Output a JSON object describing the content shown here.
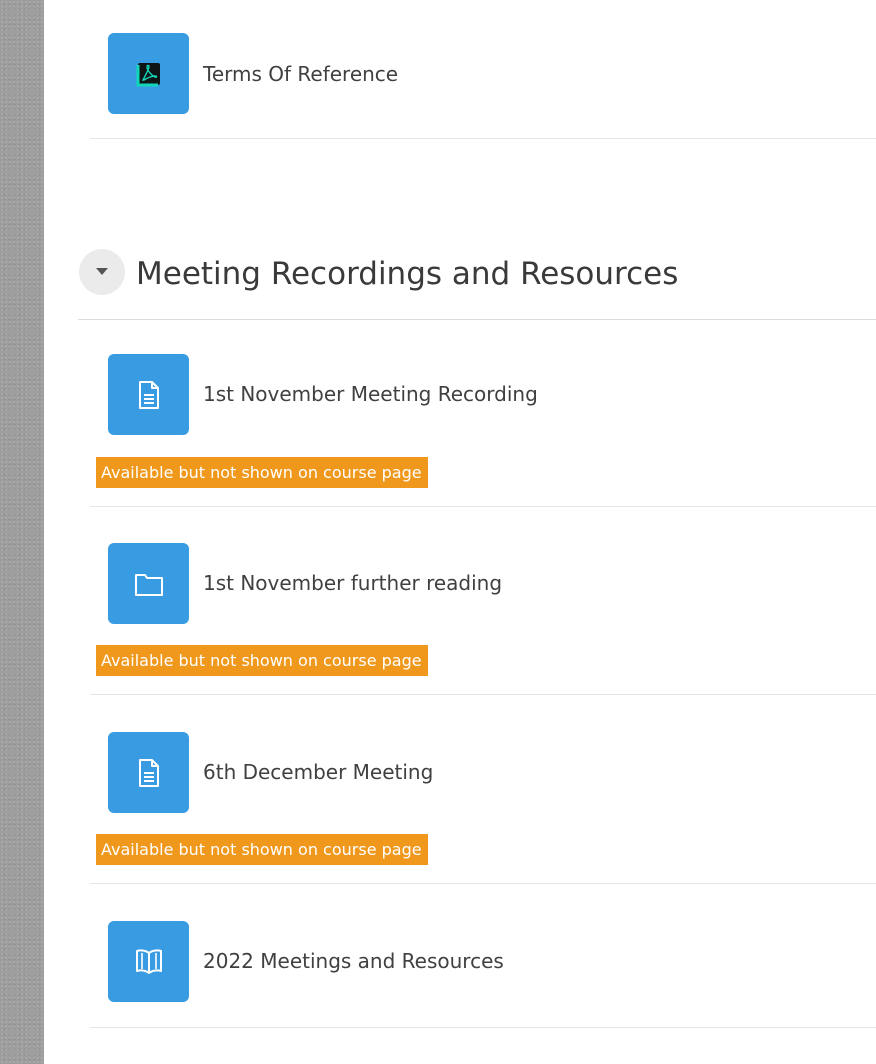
{
  "top_activity": {
    "label": "Terms Of Reference",
    "icon": "pdf-icon"
  },
  "section": {
    "title": "Meeting Recordings and Resources",
    "toggle_icon": "caret-down-icon"
  },
  "activities": [
    {
      "label": "1st November Meeting Recording",
      "icon": "page-icon",
      "badge": "Available but not shown on course page"
    },
    {
      "label": "1st November further reading",
      "icon": "folder-icon",
      "badge": "Available but not shown on course page"
    },
    {
      "label": "6th December Meeting",
      "icon": "page-icon",
      "badge": "Available but not shown on course page"
    },
    {
      "label": "2022 Meetings and Resources",
      "icon": "book-icon"
    }
  ],
  "colors": {
    "icon_background": "#399be2",
    "badge_background": "#f0981c",
    "badge_text": "#ffffff",
    "pdf_icon_accent": "#12d6b8"
  }
}
